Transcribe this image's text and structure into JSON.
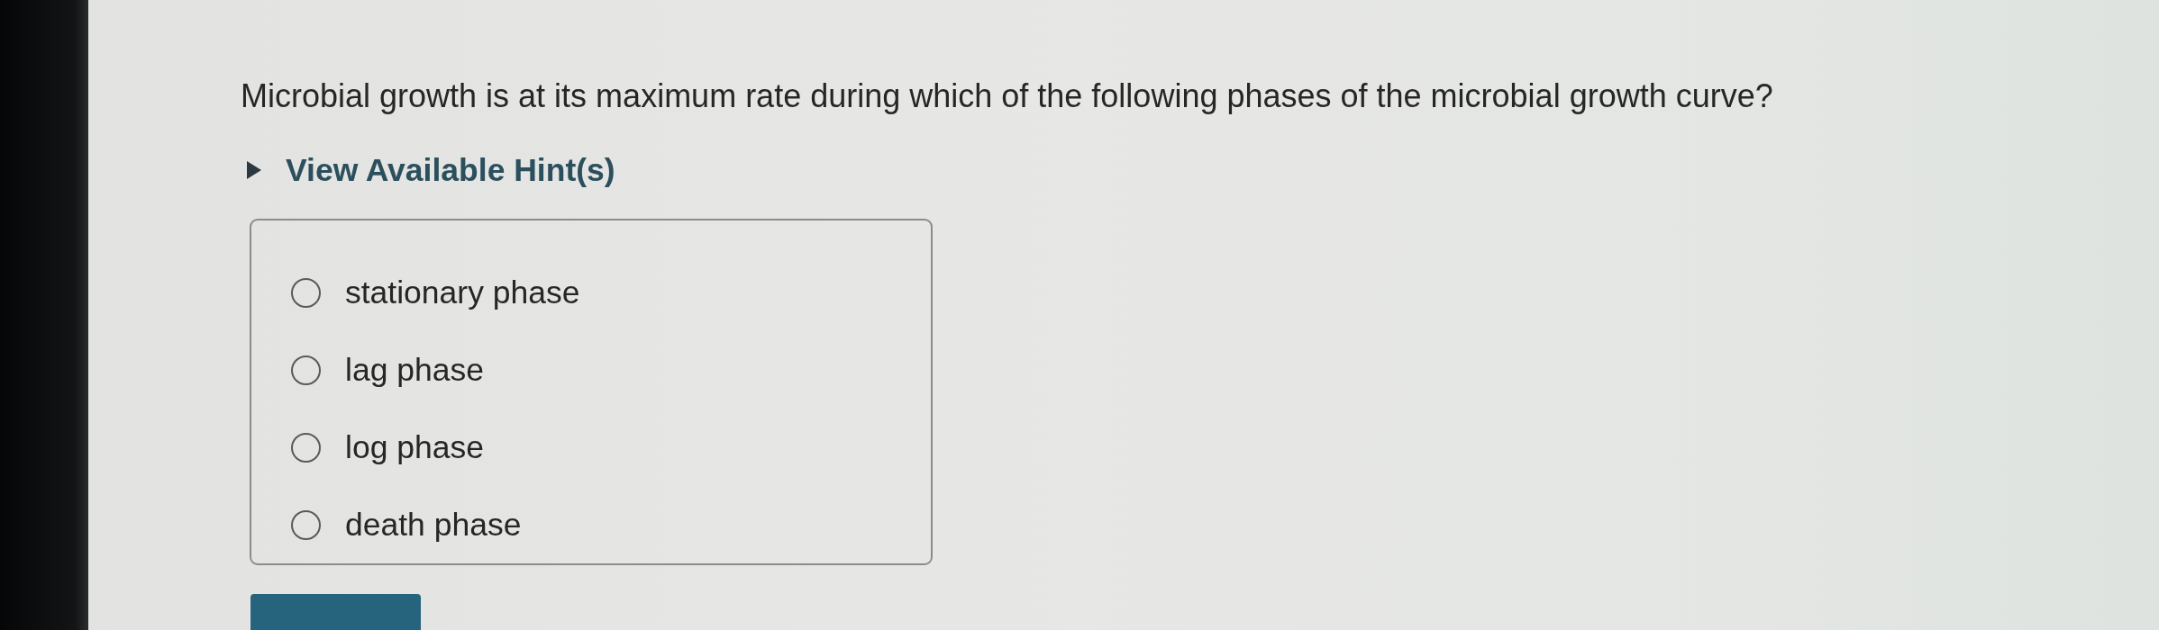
{
  "question": {
    "text": "Microbial growth is at its maximum rate during which of the following phases of the microbial growth curve?"
  },
  "hint": {
    "label": "View Available Hint(s)",
    "expanded": false
  },
  "options": [
    {
      "label": "stationary phase",
      "selected": false
    },
    {
      "label": "lag phase",
      "selected": false
    },
    {
      "label": "log phase",
      "selected": false
    },
    {
      "label": "death phase",
      "selected": false
    }
  ]
}
